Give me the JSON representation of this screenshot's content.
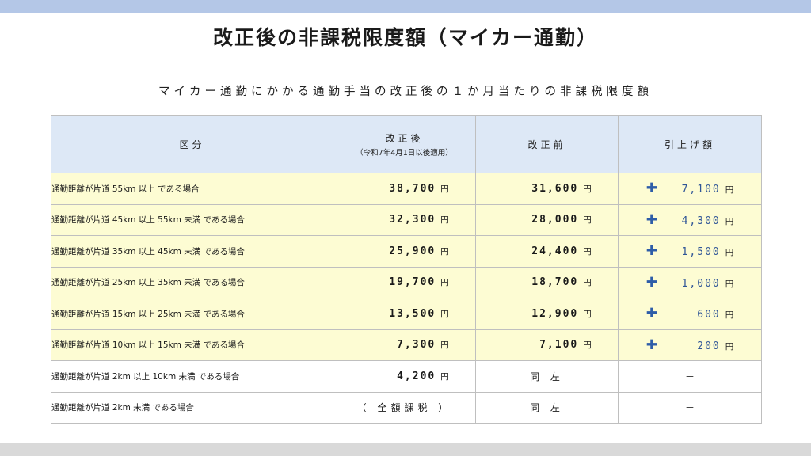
{
  "title": "改正後の非課税限度額（マイカー通勤）",
  "subtitle": "マイカー通勤にかかる通勤手当の改正後の１か月当たりの非課税限度額",
  "table": {
    "headers": {
      "category": "区分",
      "after": "改正後",
      "after_note": "（令和7年4月1日以後適用）",
      "before": "改正前",
      "increase": "引上げ額"
    },
    "unit": "円",
    "plus_symbol": "✚",
    "rows": [
      {
        "category": "通勤距離が片道 55km 以上 である場合",
        "after": "38,700",
        "before": "31,600",
        "increase": "7,100"
      },
      {
        "category": "通勤距離が片道 45km 以上 55km 未満 である場合",
        "after": "32,300",
        "before": "28,000",
        "increase": "4,300"
      },
      {
        "category": "通勤距離が片道 35km 以上 45km 未満 である場合",
        "after": "25,900",
        "before": "24,400",
        "increase": "1,500"
      },
      {
        "category": "通勤距離が片道 25km 以上 35km 未満 である場合",
        "after": "19,700",
        "before": "18,700",
        "increase": "1,000"
      },
      {
        "category": "通勤距離が片道 15km 以上 25km 未満 である場合",
        "after": "13,500",
        "before": "12,900",
        "increase": "600"
      },
      {
        "category": "通勤距離が片道 10km 以上 15km 未満 である場合",
        "after": "7,300",
        "before": "7,100",
        "increase": "200"
      },
      {
        "category": "通勤距離が片道 2km 以上 10km 未満 である場合",
        "after": "4,200",
        "before": "同 左",
        "increase": "－"
      },
      {
        "category": "通勤距離が片道 2km 未満 である場合",
        "after": "（ 全額課税 ）",
        "before": "同 左",
        "increase": "－"
      }
    ]
  },
  "colors": {
    "top_band": "#b4c7e7",
    "header_bg": "#dde8f6",
    "highlight_row": "#fdfcd3",
    "increase_text": "#2f5597",
    "bottom_band": "#d9d9d9"
  }
}
